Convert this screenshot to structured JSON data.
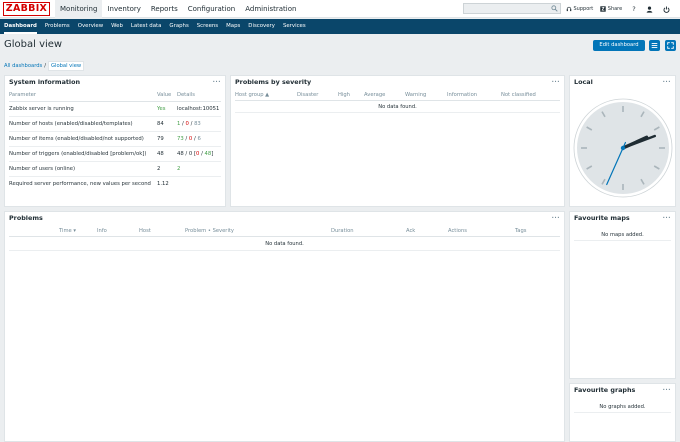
{
  "app": {
    "logo": "ZABBIX"
  },
  "main_menu": [
    {
      "label": "Monitoring",
      "active": true
    },
    {
      "label": "Inventory"
    },
    {
      "label": "Reports"
    },
    {
      "label": "Configuration"
    },
    {
      "label": "Administration"
    }
  ],
  "search": {
    "value": ""
  },
  "top_icons": {
    "support": "Support",
    "share": "Share",
    "help": "?"
  },
  "sub_menu": [
    {
      "label": "Dashboard",
      "active": true
    },
    {
      "label": "Problems"
    },
    {
      "label": "Overview"
    },
    {
      "label": "Web"
    },
    {
      "label": "Latest data"
    },
    {
      "label": "Graphs"
    },
    {
      "label": "Screens"
    },
    {
      "label": "Maps"
    },
    {
      "label": "Discovery"
    },
    {
      "label": "Services"
    }
  ],
  "page": {
    "title": "Global view",
    "edit_button": "Edit dashboard"
  },
  "breadcrumb": {
    "parent": "All dashboards",
    "sep": "/",
    "current": "Global view"
  },
  "system_info": {
    "title": "System information",
    "menu": "...",
    "headers": {
      "parameter": "Parameter",
      "value": "Value",
      "details": "Details"
    },
    "rows": [
      {
        "parameter": "Zabbix server is running",
        "value": "Yes",
        "details": "localhost:10051"
      },
      {
        "parameter": "Number of hosts (enabled/disabled/templates)",
        "value": "84",
        "d1": "1",
        "s1": " / ",
        "d2": "0",
        "s2": " / ",
        "d3": "83"
      },
      {
        "parameter": "Number of items (enabled/disabled/not supported)",
        "value": "79",
        "d1": "73",
        "s1": " / ",
        "d2": "0",
        "s2": " / ",
        "d3": "6"
      },
      {
        "parameter": "Number of triggers (enabled/disabled [problem/ok])",
        "value": "48",
        "details_prefix": "48 / 0 [",
        "d1": "0",
        "s1": " / ",
        "d2": "48",
        "s2": "]"
      },
      {
        "parameter": "Number of users (online)",
        "value": "2",
        "details": "2"
      },
      {
        "parameter": "Required server performance, new values per second",
        "value": "1.12",
        "details": ""
      }
    ]
  },
  "problems_by_severity": {
    "title": "Problems by severity",
    "menu": "...",
    "columns": [
      "Host group ▲",
      "Disaster",
      "High",
      "Average",
      "Warning",
      "Information",
      "Not classified"
    ],
    "empty": "No data found."
  },
  "local_clock": {
    "title": "Local",
    "menu": "...",
    "hour": 2,
    "minute": 11,
    "second": 34
  },
  "problems": {
    "title": "Problems",
    "menu": "...",
    "columns": [
      "Time ▾",
      "Info",
      "Host",
      "Problem • Severity",
      "Duration",
      "Ack",
      "Actions",
      "Tags"
    ],
    "empty": "No data found."
  },
  "favourite_maps": {
    "title": "Favourite maps",
    "menu": "...",
    "empty": "No maps added."
  },
  "favourite_graphs": {
    "title": "Favourite graphs",
    "menu": "...",
    "empty": "No graphs added."
  },
  "colors": {
    "nav": "#0a466a",
    "accent": "#0275b8",
    "ok": "#429e47",
    "problem": "#d40000"
  }
}
